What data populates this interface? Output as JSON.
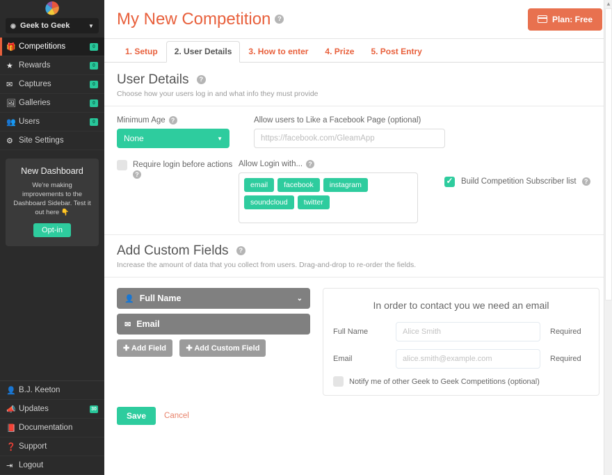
{
  "sidebar": {
    "logo_name": "gleam-pinwheel-logo",
    "brand": {
      "label": "Geek to Geek",
      "icon": "globe-icon",
      "caret": "▼"
    },
    "items": [
      {
        "label": "Competitions",
        "icon": "gift-icon",
        "badge": "0",
        "active": true
      },
      {
        "label": "Rewards",
        "icon": "star-icon",
        "badge": "0",
        "active": false
      },
      {
        "label": "Captures",
        "icon": "envelope-icon",
        "badge": "0",
        "active": false
      },
      {
        "label": "Galleries",
        "icon": "image-icon",
        "badge": "0",
        "active": false
      },
      {
        "label": "Users",
        "icon": "users-icon",
        "badge": "0",
        "active": false
      },
      {
        "label": "Site Settings",
        "icon": "gears-icon",
        "badge": "",
        "active": false
      }
    ],
    "promo": {
      "title": "New Dashboard",
      "body": "We're making improvements to the Dashboard Sidebar. Test it out here 👇",
      "button": "Opt-in"
    },
    "bottom_items": [
      {
        "label": "B.J. Keeton",
        "icon": "user-icon",
        "badge": ""
      },
      {
        "label": "Updates",
        "icon": "megaphone-icon",
        "badge": "30"
      },
      {
        "label": "Documentation",
        "icon": "book-icon",
        "badge": ""
      },
      {
        "label": "Support",
        "icon": "question-circle-icon",
        "badge": ""
      },
      {
        "label": "Logout",
        "icon": "logout-icon",
        "badge": ""
      }
    ]
  },
  "header": {
    "title": "My New Competition",
    "help": "?",
    "plan_button": "Plan: Free"
  },
  "tabs": [
    {
      "label": "1. Setup",
      "active": false
    },
    {
      "label": "2. User Details",
      "active": true
    },
    {
      "label": "3. How to enter",
      "active": false
    },
    {
      "label": "4. Prize",
      "active": false
    },
    {
      "label": "5. Post Entry",
      "active": false
    }
  ],
  "user_details": {
    "title": "User Details",
    "subtitle": "Choose how your users log in and what info they must provide",
    "min_age_label": "Minimum Age",
    "min_age_value": "None",
    "facebook_label": "Allow users to Like a Facebook Page (optional)",
    "facebook_placeholder": "https://facebook.com/GleamApp",
    "require_login_label": "Require login before actions",
    "require_login_checked": false,
    "allow_login_label": "Allow Login with...",
    "login_tags": [
      "email",
      "facebook",
      "instagram",
      "soundcloud",
      "twitter"
    ],
    "subscriber_label": "Build Competition Subscriber list",
    "subscriber_checked": true
  },
  "custom_fields": {
    "title": "Add Custom Fields",
    "subtitle": "Increase the amount of data that you collect from users. Drag-and-drop to re-order the fields.",
    "fields": [
      {
        "label": "Full Name",
        "icon": "user-icon",
        "has_caret": true
      },
      {
        "label": "Email",
        "icon": "envelope-icon",
        "has_caret": false
      }
    ],
    "add_field_button": "Add Field",
    "add_custom_field_button": "Add Custom Field"
  },
  "preview": {
    "title": "In order to contact you we need an email",
    "rows": [
      {
        "label": "Full Name",
        "placeholder": "Alice Smith",
        "required": "Required"
      },
      {
        "label": "Email",
        "placeholder": "alice.smith@example.com",
        "required": "Required"
      }
    ],
    "notify_label": "Notify me of other Geek to Geek Competitions (optional)",
    "notify_checked": false
  },
  "footer": {
    "save": "Save",
    "cancel": "Cancel"
  },
  "colors": {
    "accent_orange": "#e8603c",
    "accent_green": "#2ecc9e",
    "sidebar_bg": "#2b2b2b",
    "plan_button": "#e8714f"
  }
}
